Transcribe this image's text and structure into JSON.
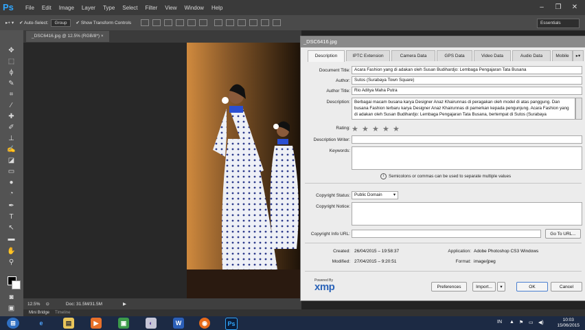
{
  "app": {
    "logo": "Ps",
    "menu": [
      "File",
      "Edit",
      "Image",
      "Layer",
      "Type",
      "Select",
      "Filter",
      "View",
      "Window",
      "Help"
    ],
    "window_controls": [
      "–",
      "❐",
      "✕"
    ]
  },
  "options": {
    "auto_select": "Auto-Select:",
    "group": "Group",
    "show_transform": "Show Transform Controls",
    "workspace": "Essentials"
  },
  "document": {
    "tab": "_DSC6416.jpg @ 12.5% (RGB/8*)",
    "zoom": "12.5%",
    "doc_size": "Doc: 31.5M/31.5M"
  },
  "panels": {
    "mini_bridge": "Mini Bridge",
    "timeline": "Timeline"
  },
  "dialog": {
    "title": "_DSC6416.jpg",
    "tabs": [
      "Description",
      "IPTC Extension",
      "Camera Data",
      "GPS Data",
      "Video Data",
      "Audio Data",
      "Mobile"
    ],
    "labels": {
      "document_title": "Document Title:",
      "author": "Author:",
      "author_title": "Author Title:",
      "description": "Description:",
      "rating": "Rating:",
      "description_writer": "Description Writer:",
      "keywords": "Keywords:",
      "copyright_status": "Copyright Status:",
      "copyright_notice": "Copyright Notice:",
      "copyright_url": "Copyright Info URL:",
      "created": "Created:",
      "modified": "Modified:",
      "application": "Application:",
      "format": "Format:"
    },
    "values": {
      "document_title": "Acara Fashion yang di adakan oleh Susan Budihardjo: Lembaga Pengajaran Tata Busana",
      "author": "Sutos (Surabaya Town Square)",
      "author_title": "Rio Aditya Maha Putra",
      "description": "Berbagai macam busana karya Designer Anaz Khairunnas di peragakan oleh model di atas panggung. Dan busana Fashion terbaru karya Designer Anaz Khairunnas di pamerkan kepada pengunjung. Acara Fashion yang di adakan oleh Susan Budihardjo: Lembaga Pengajaran Tata Busana, bertempat di Sutos (Surabaya",
      "rating_stars": "★",
      "keywords_hint": "Semicolons or commas can be used to separate multiple values",
      "copyright_status": "Public Domain",
      "created": "26/04/2015 – 19:58:37",
      "modified": "27/04/2015 – 9:20:51",
      "application": "Adobe Photoshop CS3 Windows",
      "format": "image/jpeg"
    },
    "buttons": {
      "go_to_url": "Go To URL...",
      "preferences": "Preferences",
      "import": "Import...",
      "ok": "OK",
      "cancel": "Cancel"
    },
    "logo": {
      "powered_by": "Powered By",
      "xmp": "xmp"
    }
  },
  "taskbar": {
    "lang": "IN",
    "time": "10:03",
    "date": "15/06/2015"
  }
}
